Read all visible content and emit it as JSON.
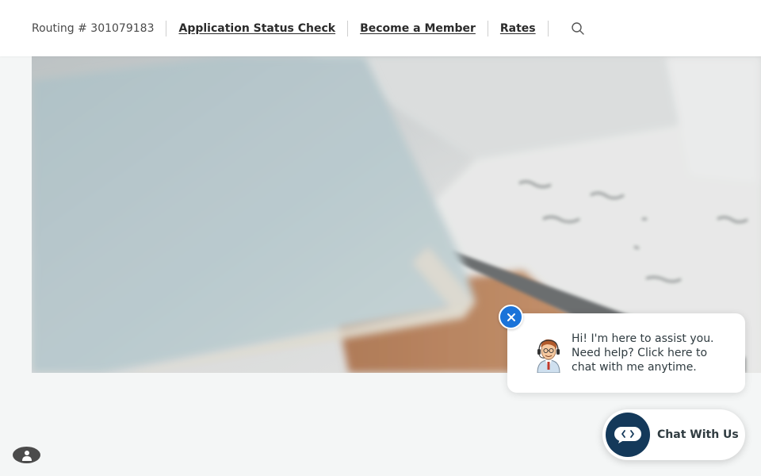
{
  "header": {
    "routing_text": "Routing # 301079183",
    "nav_links": [
      {
        "label": "Application Status Check"
      },
      {
        "label": "Become a Member"
      },
      {
        "label": "Rates"
      }
    ],
    "search_icon": "search-icon"
  },
  "hero": {
    "image_description_icon": "hero-image"
  },
  "chat_popup": {
    "message": "Hi! I'm here to assist you. Need help? Click here to chat with me anytime.",
    "close_icon": "close-icon",
    "avatar_icon": "support-agent-avatar"
  },
  "chat_launcher": {
    "label": "Chat With Us",
    "icon": "chat-icon"
  },
  "accessibility": {
    "icon": "accessibility-icon"
  },
  "colors": {
    "header_bg": "#ffffff",
    "page_bg": "#f4f6f6",
    "close_button": "#1a73d9",
    "chat_icon_bg": "#14395a",
    "text_dark": "#2f3b40"
  }
}
